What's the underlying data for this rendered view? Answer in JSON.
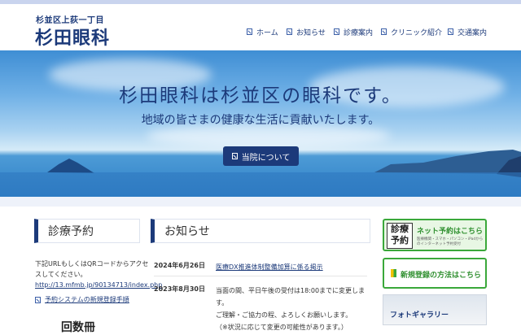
{
  "header": {
    "subtitle": "杉並区上荻一丁目",
    "logo": "杉田眼科",
    "nav": [
      {
        "label": "ホーム"
      },
      {
        "label": "お知らせ"
      },
      {
        "label": "診療案内"
      },
      {
        "label": "クリニック紹介"
      },
      {
        "label": "交通案内"
      }
    ]
  },
  "hero": {
    "title": "杉田眼科は杉並区の眼科です。",
    "subtitle": "地域の皆さまの健康な生活に貢献いたします。",
    "button": "当院について"
  },
  "reservation": {
    "title": "診療予約",
    "description": "下記URLもしくはQRコードからアクセスしてください。",
    "url": "http://13.mfmb.jp/90134713/index.php",
    "manual_link": "予約システムの新規登録手順",
    "bottom_text": "回数冊"
  },
  "news": {
    "title": "お知らせ",
    "items": [
      {
        "date": "2024年6月26日",
        "text": "医療DX推進体制整備加算に係る掲示"
      },
      {
        "date": "2023年8月30日",
        "lines": [
          "当面の間、平日午後の受付は18:00までに変更します。",
          "ご理解・ご協力の程、よろしくお願いします。",
          "（※状況に応じて変更の可能性があります。）"
        ]
      }
    ]
  },
  "sidebar": {
    "banner1_badge": "診療予約",
    "banner1_title": "ネット予約はこちら",
    "banner1_small": "医療機関・スマホ・パソコン・iPadからのインターネット予約受付",
    "banner2_title": "新規登録の方法はこちら",
    "gallery_title": "フォトギャラリー"
  },
  "colors": {
    "brand": "#1c3a7a",
    "green": "#3aa83a"
  }
}
